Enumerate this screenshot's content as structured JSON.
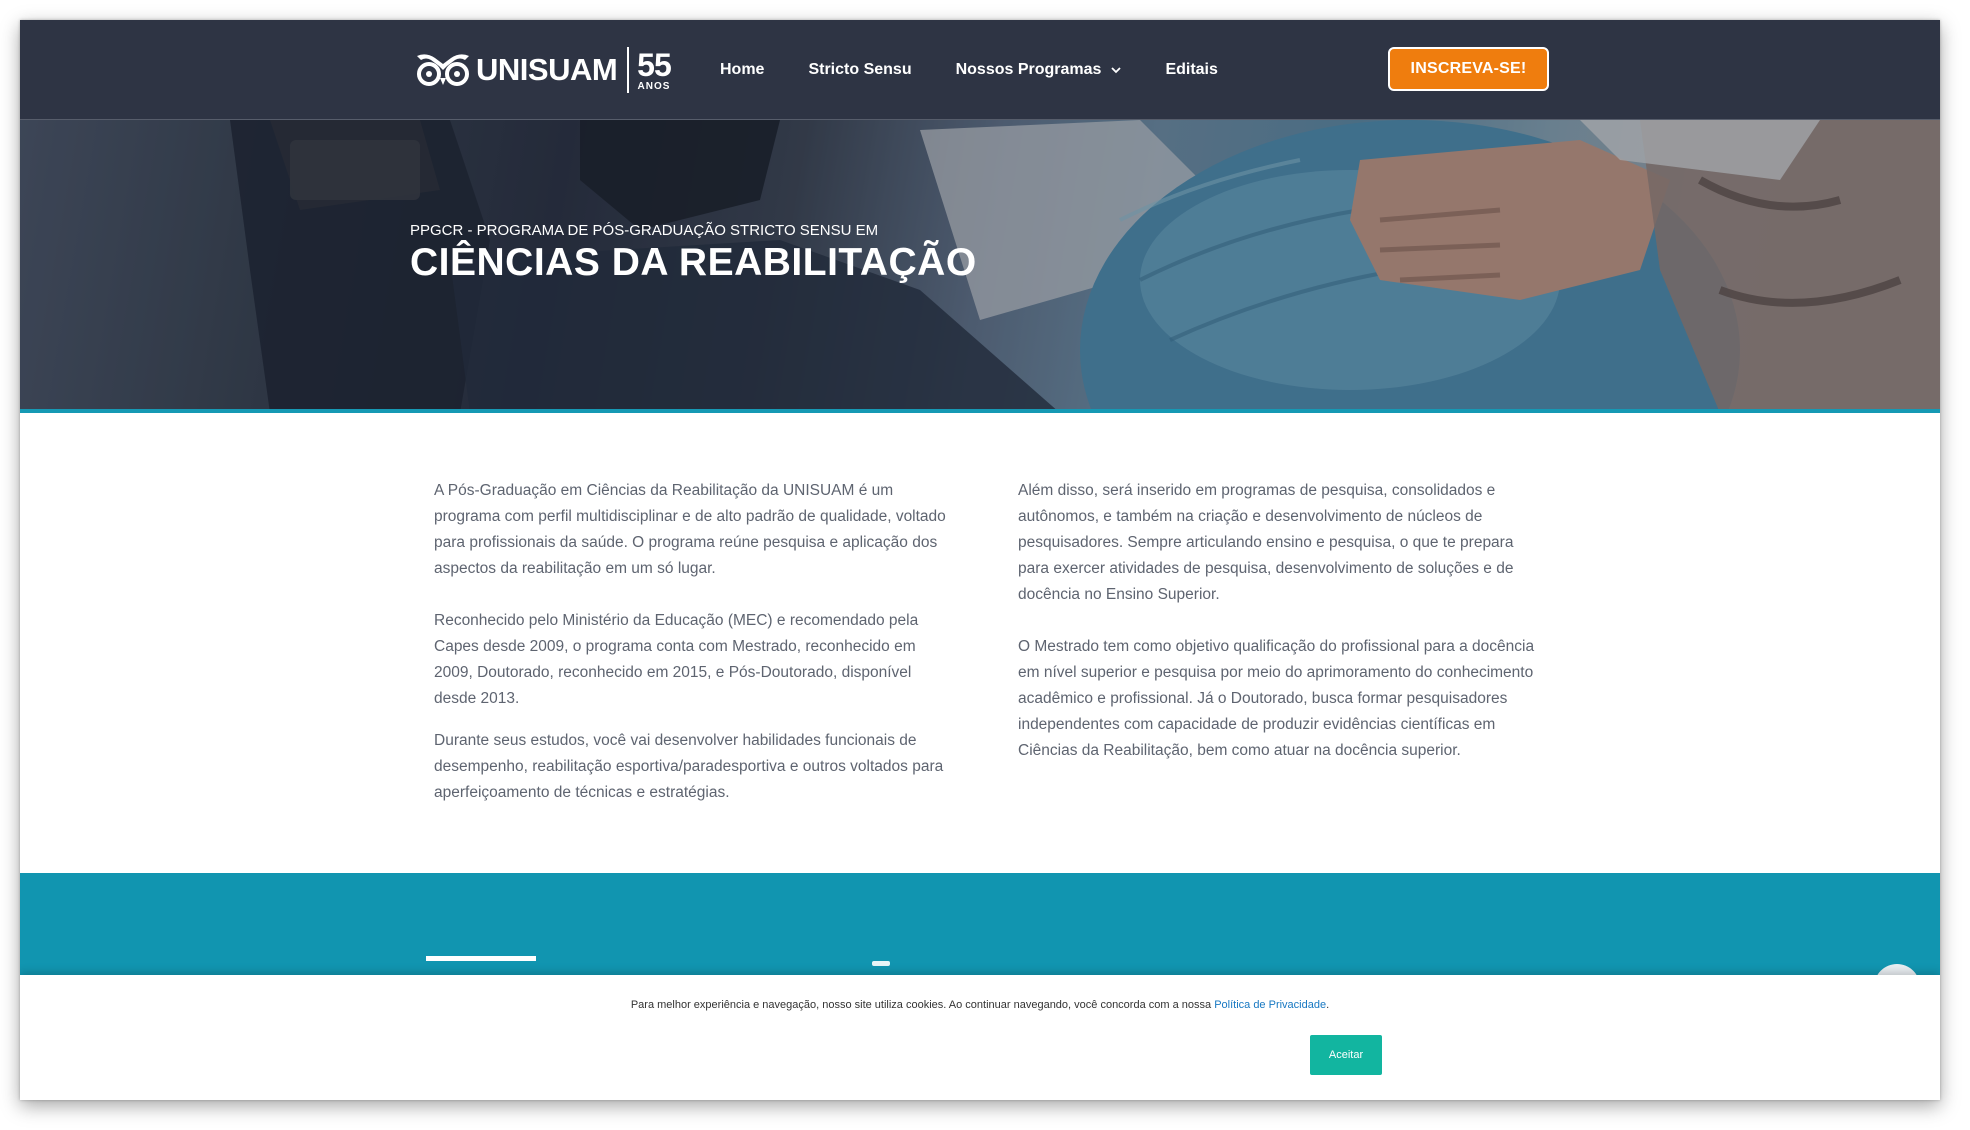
{
  "brand": {
    "name": "UNISUAM",
    "years_number": "55",
    "years_word": "ANOS"
  },
  "nav": {
    "items": [
      {
        "label": "Home"
      },
      {
        "label": "Stricto Sensu"
      },
      {
        "label": "Nossos Programas"
      },
      {
        "label": "Editais"
      }
    ],
    "cta_label": "INSCREVA-SE!"
  },
  "hero": {
    "subtitle": "PPGCR - PROGRAMA DE PÓS-GRADUAÇÃO STRICTO SENSU EM",
    "title": "CIÊNCIAS DA REABILITAÇÃO"
  },
  "content": {
    "left": [
      "A Pós-Graduação em Ciências da Reabilitação da UNISUAM é um programa com perfil multidisciplinar e de alto padrão de qualidade, voltado para profissionais da saúde. O programa reúne pesquisa e aplicação dos aspectos da reabilitação em um só lugar.",
      "Reconhecido pelo Ministério da Educação (MEC) e recomendado pela Capes desde 2009, o programa conta com Mestrado, reconhecido em 2009, Doutorado, reconhecido em 2015, e Pós-Doutorado, disponível desde 2013.",
      "Durante seus estudos, você vai desenvolver habilidades funcionais de desempenho, reabilitação esportiva/paradesportiva e outros voltados para aperfeiçoamento de técnicas e estratégias."
    ],
    "right": [
      "Além disso, será inserido em programas de pesquisa, consolidados e autônomos, e também na criação e desenvolvimento de núcleos de pesquisadores. Sempre articulando ensino e pesquisa, o que te prepara para exercer atividades de pesquisa, desenvolvimento de soluções e de docência no Ensino Superior.",
      "O Mestrado tem como objetivo qualificação do profissional para a docência em nível superior e pesquisa por meio do aprimoramento do conhecimento acadêmico e profissional. Já o Doutorado, busca formar pesquisadores independentes com capacidade de produzir evidências científicas em Ciências da Reabilitação, bem como atuar na docência superior."
    ]
  },
  "cookie": {
    "text": "Para melhor experiência e navegação, nosso site utiliza cookies. Ao continuar navegando, você concorda com a nossa ",
    "link": "Política de Privacidade",
    "link_suffix": ".",
    "accept_label": "Aceitar"
  },
  "colors": {
    "navbar": "#2e3444",
    "cta": "#ef7d0e",
    "accent_teal": "#1195b0",
    "cookie_button": "#12b5a0",
    "body_text": "#5e6470"
  },
  "icons": {
    "logo": "owl-logo-icon",
    "dropdown": "chevron-down-icon",
    "scroll_top": "scroll-top-icon"
  }
}
